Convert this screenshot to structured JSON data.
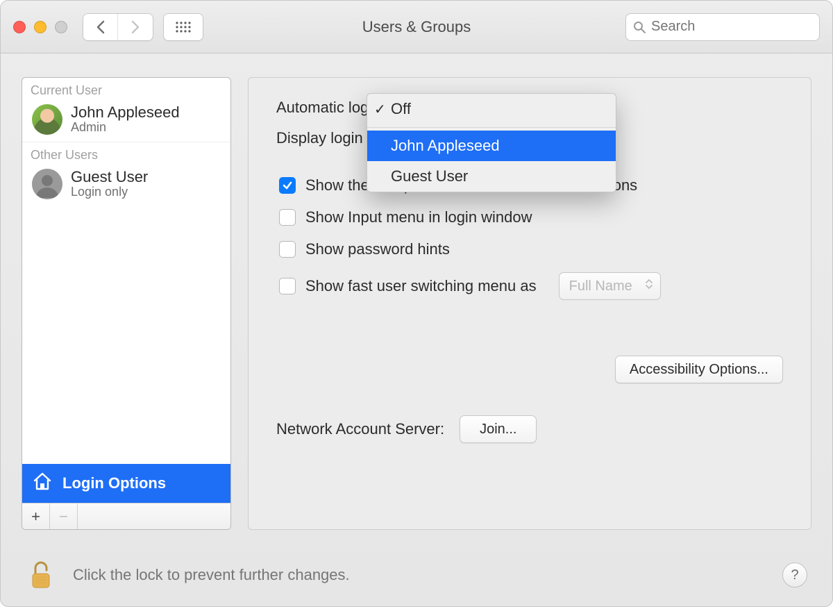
{
  "window": {
    "title": "Users & Groups"
  },
  "search": {
    "placeholder": "Search"
  },
  "sidebar": {
    "current_label": "Current User",
    "other_label": "Other Users",
    "users": [
      {
        "name": "John Appleseed",
        "role": "Admin"
      },
      {
        "name": "Guest User",
        "role": "Login only"
      }
    ],
    "login_options_label": "Login Options"
  },
  "panel": {
    "auto_login_label": "Automatic login",
    "display_login_label": "Display login wi",
    "chk_sleep": "Show the Sleep, Restart, and Shut Down buttons",
    "chk_input": "Show Input menu in login window",
    "chk_hints": "Show password hints",
    "chk_fast": "Show fast user switching menu as",
    "fast_select": "Full Name",
    "accessibility_btn": "Accessibility Options...",
    "nas_label": "Network Account Server:",
    "join_btn": "Join..."
  },
  "dropdown": {
    "options": [
      "Off",
      "John Appleseed",
      "Guest User"
    ],
    "checked_index": 0,
    "highlight_index": 1
  },
  "footer": {
    "lock_text": "Click the lock to prevent further changes.",
    "help": "?"
  }
}
